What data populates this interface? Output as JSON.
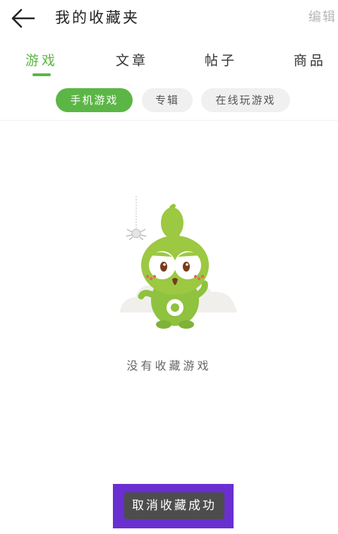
{
  "header": {
    "back_icon": "arrow-left-icon",
    "title": "我的收藏夹",
    "edit_label": "编辑"
  },
  "tabs": [
    {
      "label": "游戏",
      "active": true
    },
    {
      "label": "文章",
      "active": false
    },
    {
      "label": "帖子",
      "active": false
    },
    {
      "label": "商品",
      "active": false
    }
  ],
  "chips": [
    {
      "label": "手机游戏",
      "active": true
    },
    {
      "label": "专辑",
      "active": false
    },
    {
      "label": "在线玩游戏",
      "active": false
    }
  ],
  "empty_state": {
    "illustration": "green-mascot-with-spider",
    "message": "没有收藏游戏"
  },
  "toast": {
    "message": "取消收藏成功"
  },
  "colors": {
    "accent": "#5bb643",
    "chip_inactive_bg": "#f0f0f0",
    "toast_bg": "#4d4d4d",
    "highlight_border": "#6a2fd0"
  }
}
